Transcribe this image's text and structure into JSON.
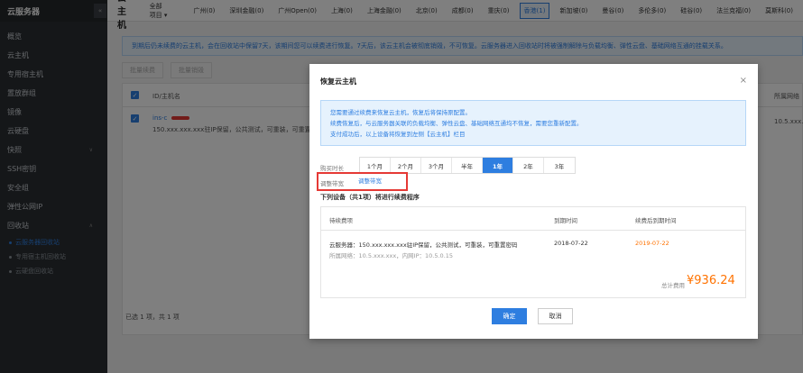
{
  "sidebar": {
    "brand": "云服务器",
    "collapse_icon": "«",
    "items": [
      {
        "label": "概览"
      },
      {
        "label": "云主机"
      },
      {
        "label": "专用宿主机"
      },
      {
        "label": "置放群组"
      },
      {
        "label": "镜像"
      },
      {
        "label": "云硬盘"
      },
      {
        "label": "快照"
      },
      {
        "label": "SSH密钥"
      },
      {
        "label": "安全组"
      },
      {
        "label": "弹性公网IP"
      },
      {
        "label": "回收站"
      }
    ],
    "sub_items": [
      {
        "label": "云服务器回收站"
      },
      {
        "label": "专用宿主机回收站"
      },
      {
        "label": "云硬盘回收站"
      }
    ]
  },
  "header": {
    "title": "云主机",
    "project": "全部项目",
    "regions": [
      "广州(0)",
      "深圳金融(0)",
      "广州Open(0)",
      "上海(0)",
      "上海金融(0)",
      "北京(0)",
      "成都(0)",
      "重庆(0)",
      "香港(1)",
      "新加坡(0)",
      "曼谷(0)",
      "多伦多(0)",
      "硅谷(0)",
      "法兰克福(0)",
      "莫斯科(0)"
    ]
  },
  "main": {
    "notice": "到期后仍未续费的云主机，会在回收站中保留7天，该期间您可以续费进行恢复。7天后，该云主机会被彻底销毁，不可恢复。云服务器进入回收站时将被强制解除与负载均衡、弹性云盘、基础网络互通的挂载关系。",
    "batch_renew": "批量续费",
    "batch_destroy": "批量销毁",
    "col_id": "ID/主机名",
    "col_ip": "所属网络",
    "row_id": "ins-c",
    "row_desc": "150.xxx.xxx.xxx驻IP保留，公共测试，可重装，可重置",
    "row_ip": "10.5.xxx.x",
    "footer": "已选 1 项，共 1 项"
  },
  "modal": {
    "title": "恢复云主机",
    "close": "×",
    "info_lines": [
      "您需要通过续费来恢复云主机，恢复后将保持原配置。",
      "续费恢复后，与云服务器关联的负载均衡、弹性云盘、基础网络互通均不恢复，需要您重新配置。",
      "支付成功后，以上设备将恢复到左侧【云主机】栏目"
    ],
    "duration_label": "购买时长",
    "durations": [
      "1个月",
      "2个月",
      "3个月",
      "半年",
      "1年",
      "2年",
      "3年"
    ],
    "active_duration": "1年",
    "adjust_label": "调整带宽",
    "adjust_link": "调整带宽",
    "process_title": "下列设备（共1项）将进行续费程序",
    "table": {
      "headers": [
        "待续费项",
        "到期时间",
        "续费后到期时间"
      ],
      "item_name": "云服务器：150.xxx.xxx.xxx驻IP保留，公共测试，可重装，可重置密码",
      "item_net": "所属网络：10.5.xxx.xxx，内网IP：10.5.0.15",
      "expire": "2018-07-22",
      "new_expire": "2019-07-22"
    },
    "total_label": "总计费用",
    "total_value": "¥936.24",
    "ok": "确定",
    "cancel": "取消"
  },
  "colors": {
    "accent": "#2e7ee0",
    "price": "#ff7200",
    "highlight_box": "#e53935"
  }
}
